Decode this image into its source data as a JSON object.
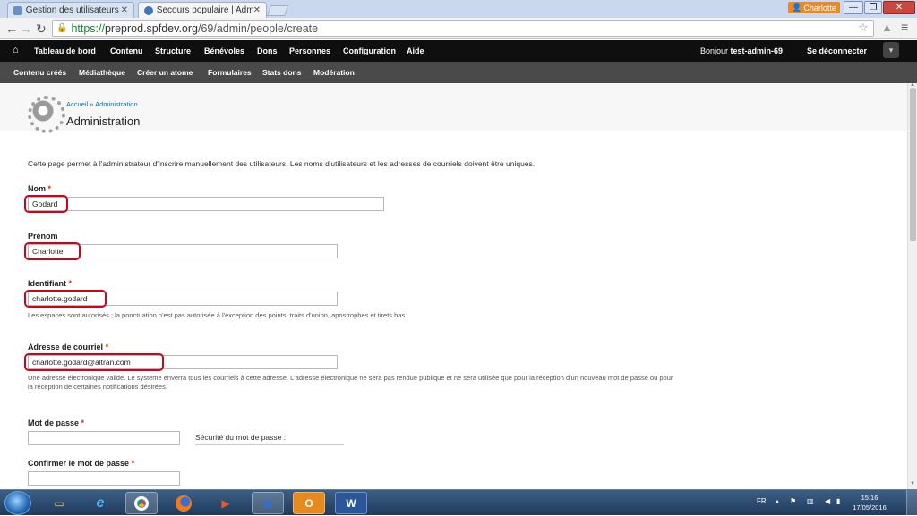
{
  "browser": {
    "tabs": [
      {
        "title": "Gestion des utilisateurs",
        "active": false
      },
      {
        "title": "Secours populaire | Admin",
        "active": true
      }
    ],
    "profile_name": "Charlotte",
    "url_scheme": "https://",
    "url_host": "preprod.spfdev.org",
    "url_path": "/69/admin/people/create"
  },
  "toolbar": {
    "items": [
      "Tableau de bord",
      "Contenu",
      "Structure",
      "Bénévoles",
      "Dons",
      "Personnes",
      "Configuration",
      "Aide"
    ],
    "greeting_prefix": "Bonjour",
    "username": "test-admin-69",
    "logout": "Se déconnecter"
  },
  "shortcuts": {
    "items": [
      "Contenu créés",
      "Médiathèque",
      "Créer un atome",
      "Formulaires",
      "Stats dons",
      "Modération"
    ]
  },
  "header": {
    "breadcrumb_home": "Accueil",
    "breadcrumb_sep": "»",
    "breadcrumb_section": "Administration",
    "title": "Administration"
  },
  "form": {
    "intro": "Cette page permet à l'administrateur d'inscrire manuellement des utilisateurs. Les noms d'utilisateurs et les adresses de courriels doivent être uniques.",
    "nom": {
      "label": "Nom",
      "value": "Godard"
    },
    "prenom": {
      "label": "Prénom",
      "value": "Charlotte"
    },
    "identifiant": {
      "label": "Identifiant",
      "value": "charlotte.godard",
      "description": "Les espaces sont autorisés ; la ponctuation n'est pas autorisée à l'exception des points, traits d'union, apostrophes et tirets bas."
    },
    "email": {
      "label": "Adresse de courriel",
      "value": "charlotte.godard@altran.com",
      "description_line1": "Une adresse électronique valide. Le système enverra tous les courriels à cette adresse. L'adresse électronique ne sera pas rendue publique et ne sera utilisée que pour la réception d'un nouveau mot de passe ou pour",
      "description_line2": "la réception de certaines notifications désirées."
    },
    "password": {
      "label": "Mot de passe",
      "value": "",
      "strength_label": "Sécurité du mot de passe :"
    },
    "confirm_password": {
      "label": "Confirmer le mot de passe",
      "value": ""
    },
    "required_marker": "*"
  },
  "taskbar": {
    "lang": "FR",
    "time": "15:16",
    "date": "17/05/2016"
  },
  "colors": {
    "highlight": "#d0021b",
    "toolbar_bg": "#0f0f0f",
    "shortcuts_bg": "#4a4a4a",
    "link": "#0074bd",
    "required": "#e32700"
  }
}
